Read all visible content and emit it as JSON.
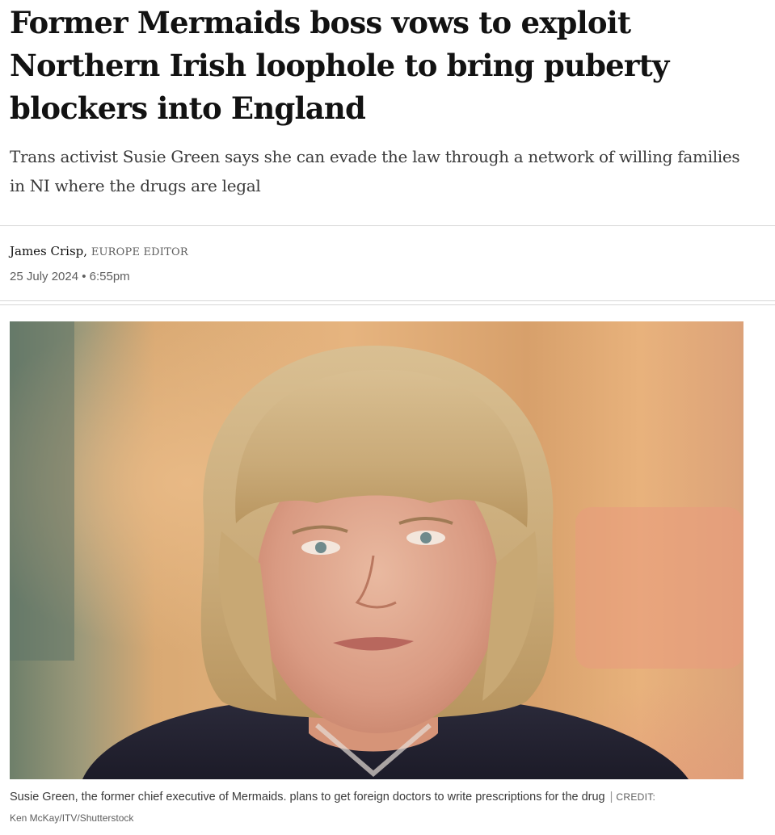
{
  "article": {
    "headline": "Former Mermaids boss vows to exploit Northern Irish loophole to bring puberty blockers into England",
    "standfirst": "Trans activist Susie Green says she can evade the law through a network of willing families in NI where the drugs are legal",
    "author": {
      "name": "James Crisp,",
      "role": "EUROPE EDITOR"
    },
    "published": "25 July 2024 • 6:55pm",
    "image": {
      "description": "Susie Green",
      "caption": "Susie Green, the former chief executive of Mermaids. plans to get foreign doctors to write prescriptions for the drug",
      "separator": "|",
      "credit_label": "CREDIT:",
      "credit": "Ken McKay/ITV/Shutterstock"
    }
  },
  "colors": {
    "text": "#121212",
    "secondary_text": "#5e5e5e",
    "rule": "#d6d6d6"
  }
}
